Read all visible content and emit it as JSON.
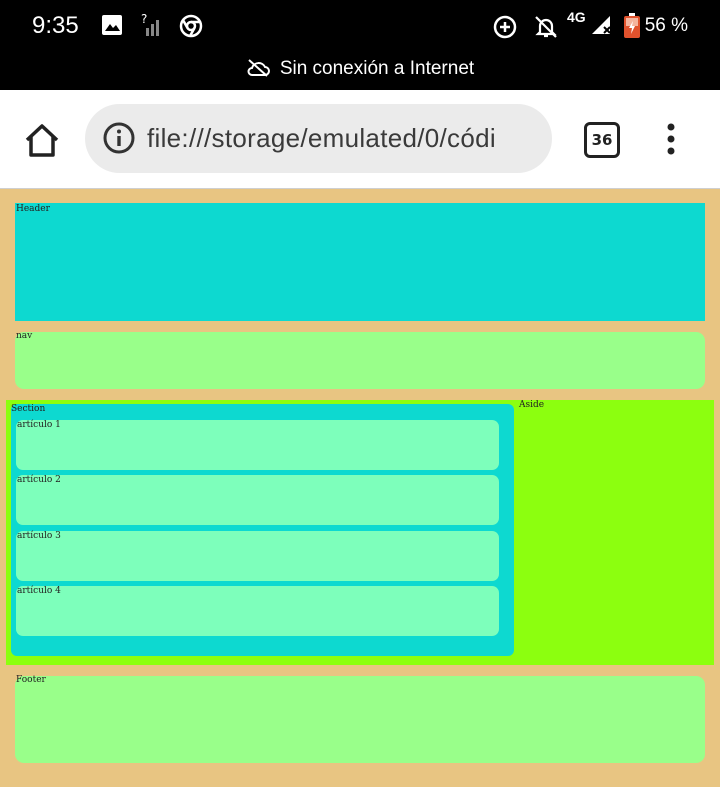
{
  "status_bar": {
    "time": "9:35",
    "network_type": "4G",
    "battery": "56 %",
    "no_internet_message": "Sin conexión a Internet"
  },
  "browser": {
    "url": "file:///storage/emulated/0/códi",
    "tab_count": "36"
  },
  "page": {
    "header_label": "Header",
    "nav_label": "nav",
    "section_label": "Section",
    "articles": [
      {
        "label": "artículo 1"
      },
      {
        "label": "artículo 2"
      },
      {
        "label": "artículo 3"
      },
      {
        "label": "artículo 4"
      }
    ],
    "aside_label": "Aside",
    "footer_label": "Footer"
  },
  "colors": {
    "page_background": "#e8c582",
    "header": "#0dd9d0",
    "nav": "#99ff8a",
    "aside": "#8cff0f",
    "section": "#0dd9d0",
    "article": "#7dffbb",
    "footer": "#99ff8a"
  }
}
